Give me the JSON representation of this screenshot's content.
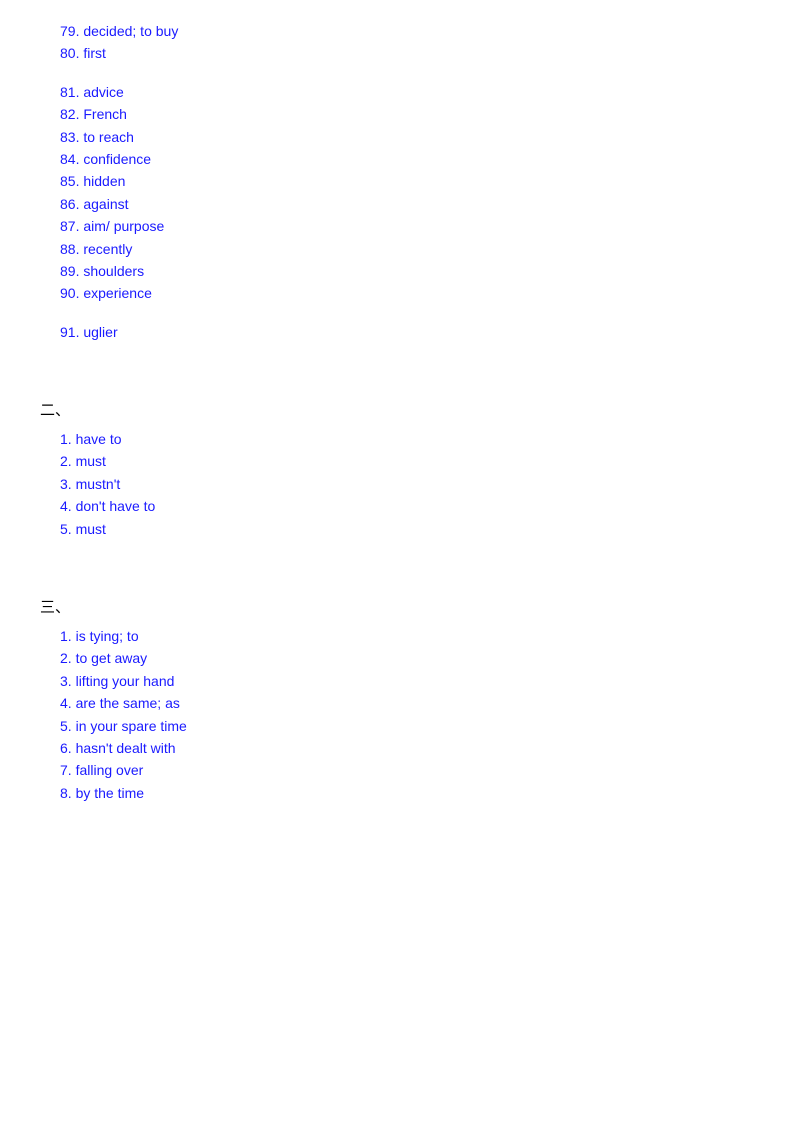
{
  "section1": {
    "items": [
      {
        "num": "79.",
        "text": "decided; to buy"
      },
      {
        "num": "80.",
        "text": "first"
      },
      {
        "num": "81.",
        "text": "advice"
      },
      {
        "num": "82.",
        "text": "French"
      },
      {
        "num": "83.",
        "text": "to reach"
      },
      {
        "num": "84.",
        "text": "confidence"
      },
      {
        "num": "85.",
        "text": "hidden"
      },
      {
        "num": "86.",
        "text": "against"
      },
      {
        "num": "87.",
        "text": "aim/ purpose"
      },
      {
        "num": "88.",
        "text": "recently"
      },
      {
        "num": "89.",
        "text": "shoulders"
      },
      {
        "num": "90.",
        "text": "experience"
      },
      {
        "num": "91.",
        "text": "uglier"
      }
    ]
  },
  "section2": {
    "header": "二、",
    "items": [
      {
        "num": "1.",
        "text": "have to"
      },
      {
        "num": "2.",
        "text": "must"
      },
      {
        "num": "3.",
        "text": "mustn't"
      },
      {
        "num": "4.",
        "text": "don't have to"
      },
      {
        "num": "5.",
        "text": "must"
      }
    ]
  },
  "section3": {
    "header": "三、",
    "items": [
      {
        "num": "1.",
        "text": "is tying; to"
      },
      {
        "num": "2.",
        "text": "to get away"
      },
      {
        "num": "3.",
        "text": "lifting your hand"
      },
      {
        "num": "4.",
        "text": "are the same; as"
      },
      {
        "num": "5.",
        "text": "in your spare time"
      },
      {
        "num": "6.",
        "text": "hasn't dealt with"
      },
      {
        "num": "7.",
        "text": "falling over"
      },
      {
        "num": "8.",
        "text": "by the time"
      }
    ]
  }
}
